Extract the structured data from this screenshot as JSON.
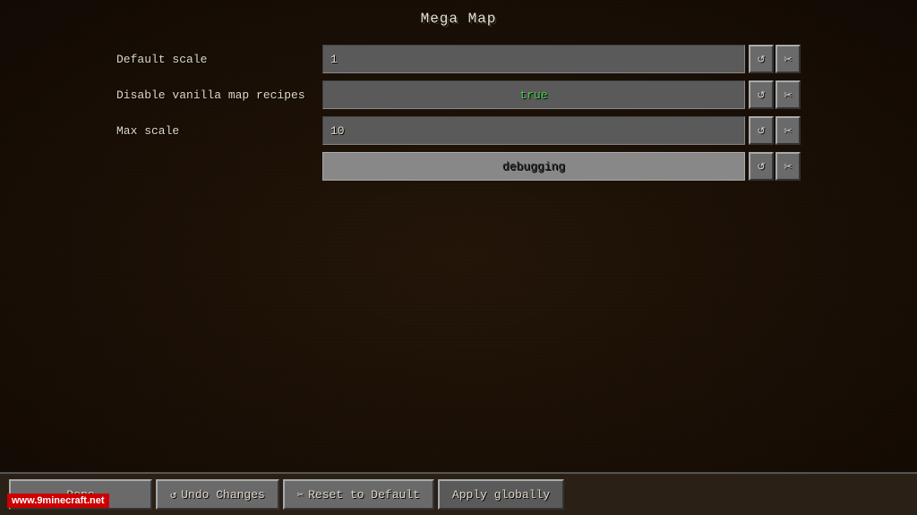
{
  "title": "Mega Map",
  "settings": [
    {
      "id": "default-scale",
      "label": "Default scale",
      "value": "1",
      "type": "text"
    },
    {
      "id": "disable-vanilla",
      "label": "Disable vanilla map recipes",
      "value": "true",
      "type": "toggle"
    },
    {
      "id": "max-scale",
      "label": "Max scale",
      "value": "10",
      "type": "text"
    }
  ],
  "debug_section": "debugging",
  "buttons": {
    "done": "Done",
    "undo": "Undo Changes",
    "reset": "Reset to Default",
    "apply": "Apply globally"
  },
  "side_buttons": {
    "reset_icon": "↺",
    "scissors_icon": "✂"
  },
  "watermark": "www.9minecraft.net"
}
